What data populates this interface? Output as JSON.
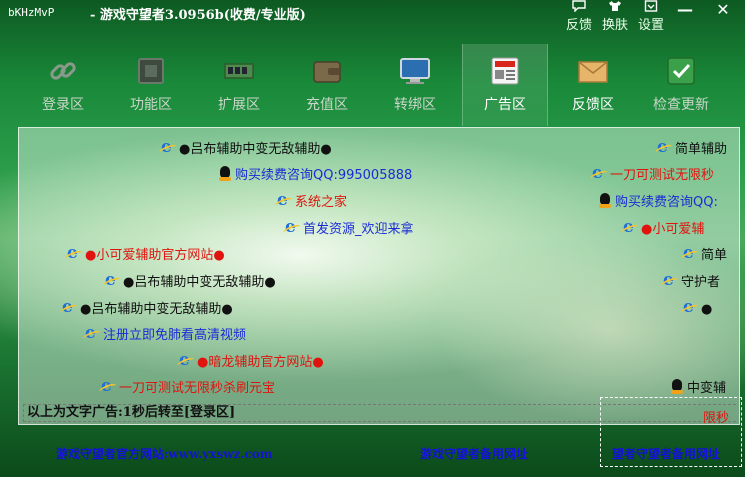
{
  "window": {
    "app_id": "bKHzMvP",
    "title": "-   游戏守望者3.0956b(收费/专业版)",
    "close_glyph": "✕",
    "minimize_glyph": "—"
  },
  "header_buttons": [
    {
      "label": "反馈",
      "icon": "chat-bubble-icon"
    },
    {
      "label": "换肤",
      "icon": "tshirt-icon"
    },
    {
      "label": "设置",
      "icon": "settings-icon"
    }
  ],
  "tabs": [
    {
      "label": "登录区",
      "icon": "chain-link-icon",
      "active": false
    },
    {
      "label": "功能区",
      "icon": "chip-icon",
      "active": false
    },
    {
      "label": "扩展区",
      "icon": "memory-module-icon",
      "active": false
    },
    {
      "label": "充值区",
      "icon": "wallet-icon",
      "active": false
    },
    {
      "label": "转绑区",
      "icon": "monitor-icon",
      "active": false
    },
    {
      "label": "广告区",
      "icon": "newspaper-icon",
      "active": true
    },
    {
      "label": "反馈区",
      "icon": "envelope-icon",
      "active": false
    },
    {
      "label": "检查更新",
      "icon": "checkmark-icon",
      "active": false
    }
  ],
  "ads": [
    {
      "text": "●吕布辅助中变无敌辅助●",
      "icon": "ie",
      "color": "black"
    },
    {
      "text": "购买续费咨询QQ:995005888",
      "icon": "qq",
      "color": "blue"
    },
    {
      "text": "系统之家",
      "icon": "ie",
      "color": "red"
    },
    {
      "text": "首发资源_欢迎来拿",
      "icon": "ie",
      "color": "blue"
    },
    {
      "text": "●小可爱辅助官方网站●",
      "icon": "ie",
      "color": "red"
    },
    {
      "text": "●吕布辅助中变无敌辅助●",
      "icon": "ie",
      "color": "black"
    },
    {
      "text": "●吕布辅助中变无敌辅助●",
      "icon": "ie",
      "color": "black"
    },
    {
      "text": "注册立即免肺看高清视频",
      "icon": "ie",
      "color": "blue"
    },
    {
      "text": "●暗龙辅助官方网站●",
      "icon": "ie",
      "color": "red"
    },
    {
      "text": "一刀可测试无限秒杀刷元宝",
      "icon": "ie",
      "color": "red"
    }
  ],
  "ads_right": [
    {
      "text": "简单辅助",
      "icon": "ie",
      "color": "black"
    },
    {
      "text": "一刀可测试无限秒",
      "icon": "ie",
      "color": "red"
    },
    {
      "text": "购买续费咨询QQ:",
      "icon": "qq",
      "color": "blue"
    },
    {
      "text": "●小可爱辅",
      "icon": "ie",
      "color": "red"
    },
    {
      "text": "简单",
      "icon": "ie",
      "color": "black"
    },
    {
      "text": "守护者",
      "icon": "ie",
      "color": "black"
    },
    {
      "text": "●",
      "icon": "ie",
      "color": "black"
    },
    {
      "text": "中变辅",
      "icon": "qq",
      "color": "black"
    },
    {
      "text": "限秒",
      "icon": "",
      "color": "red"
    }
  ],
  "status_text": "以上为文字广告:1秒后转至[登录区]",
  "footer": {
    "official": "游戏守望者官方网站:www.yxswz.com",
    "backup": "游戏守望者备用网址",
    "backup2": "望者守望者备用网址"
  },
  "colors": {
    "ad_blue": "#1a2bd6",
    "ad_red": "#e0140e",
    "footer_link": "#1412d6",
    "background_green": "#1a8a3a"
  }
}
